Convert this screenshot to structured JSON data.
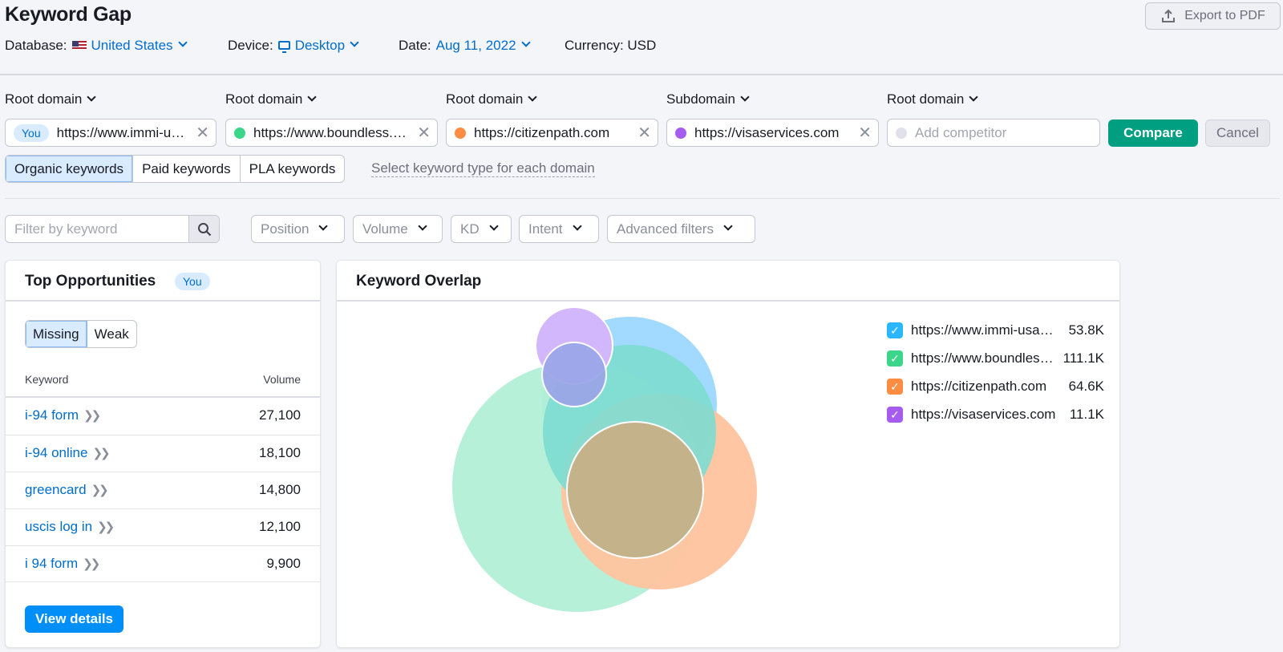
{
  "header": {
    "title": "Keyword Gap",
    "export_label": "Export to PDF",
    "database_label": "Database:",
    "database_value": "United States",
    "device_label": "Device:",
    "device_value": "Desktop",
    "date_label": "Date:",
    "date_value": "Aug 11, 2022",
    "currency": "Currency: USD"
  },
  "domains": [
    {
      "type": "Root domain",
      "value": "https://www.immi-usa.com",
      "badge": "You",
      "color": ""
    },
    {
      "type": "Root domain",
      "value": "https://www.boundless.com",
      "badge": "",
      "color": "#3cd68a"
    },
    {
      "type": "Root domain",
      "value": "https://citizenpath.com",
      "badge": "",
      "color": "#ff8c43"
    },
    {
      "type": "Subdomain",
      "value": "https://visaservices.com",
      "badge": "",
      "color": "#a75cf0"
    },
    {
      "type": "Root domain",
      "placeholder": "Add competitor",
      "color": "#e0e1e9"
    }
  ],
  "actions": {
    "compare": "Compare",
    "cancel": "Cancel"
  },
  "keyword_types": {
    "tabs": [
      "Organic keywords",
      "Paid keywords",
      "PLA keywords"
    ],
    "active": "Organic keywords",
    "hint": "Select keyword type for each domain"
  },
  "filters": {
    "search_placeholder": "Filter by keyword",
    "dropdowns": [
      "Position",
      "Volume",
      "KD",
      "Intent",
      "Advanced filters"
    ]
  },
  "top_opportunities": {
    "title": "Top Opportunities",
    "badge": "You",
    "tabs": [
      "Missing",
      "Weak"
    ],
    "active_tab": "Missing",
    "col_keyword": "Keyword",
    "col_volume": "Volume",
    "rows": [
      {
        "keyword": "i-94 form",
        "volume": "27,100"
      },
      {
        "keyword": "i-94 online",
        "volume": "18,100"
      },
      {
        "keyword": "greencard",
        "volume": "14,800"
      },
      {
        "keyword": "uscis log in",
        "volume": "12,100"
      },
      {
        "keyword": "i 94 form",
        "volume": "9,900"
      }
    ],
    "view_details": "View details"
  },
  "keyword_overlap": {
    "title": "Keyword Overlap",
    "legend": [
      {
        "label": "https://www.immi-usa.com",
        "count": "53.8K",
        "color": "#2bb7ff"
      },
      {
        "label": "https://www.boundless.com",
        "count": "111.1K",
        "color": "#3cd68a"
      },
      {
        "label": "https://citizenpath.com",
        "count": "64.6K",
        "color": "#ff8c43"
      },
      {
        "label": "https://visaservices.com",
        "count": "11.1K",
        "color": "#a75cf0"
      }
    ]
  },
  "colors": {
    "accent_blue": "#006dca",
    "compare_green": "#009f81",
    "view_details_blue": "#008ff8"
  }
}
